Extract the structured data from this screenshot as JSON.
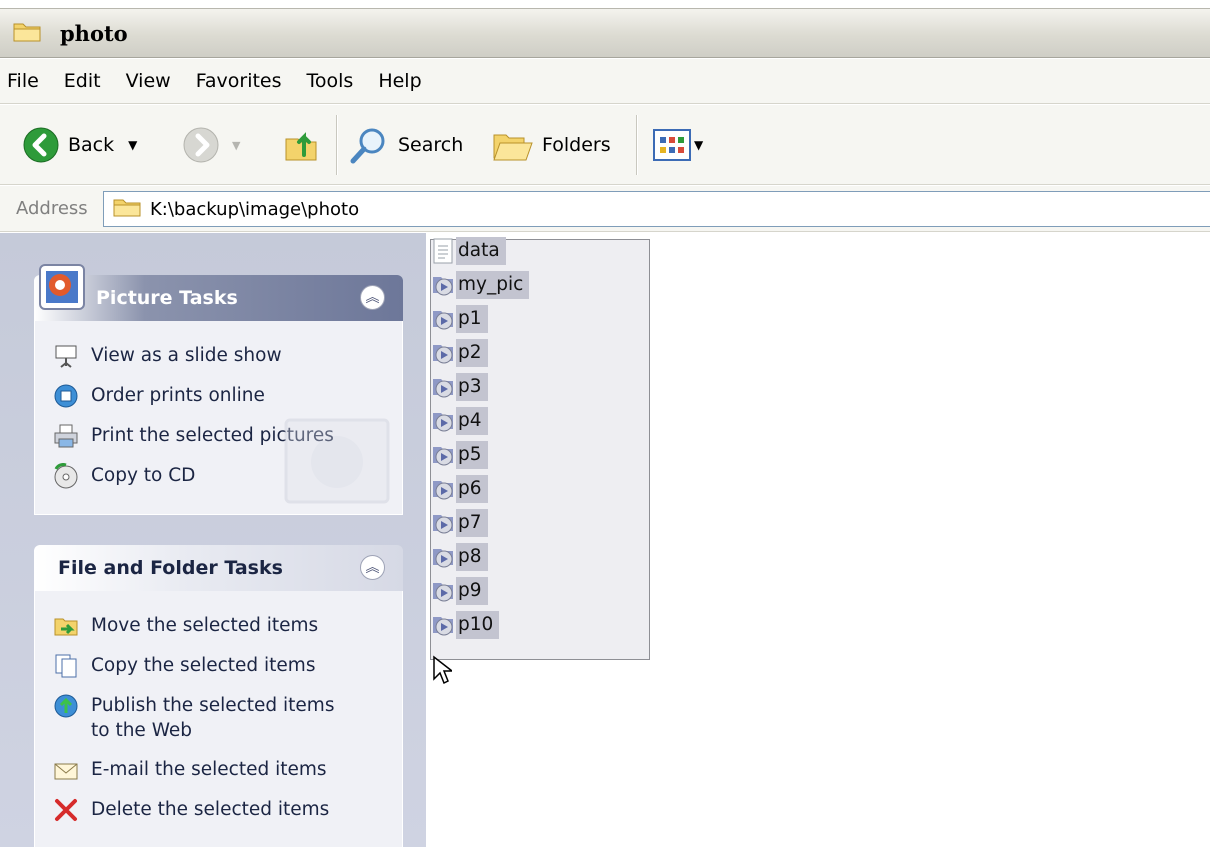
{
  "window": {
    "title": "photo"
  },
  "menu": [
    "File",
    "Edit",
    "View",
    "Favorites",
    "Tools",
    "Help"
  ],
  "toolbar": {
    "back_label": "Back",
    "search_label": "Search",
    "folders_label": "Folders"
  },
  "address": {
    "label": "Address",
    "path": "K:\\backup\\image\\photo"
  },
  "picture_tasks": {
    "title": "Picture Tasks",
    "items": [
      "View as a slide show",
      "Order prints online",
      "Print the selected pictures",
      "Copy to CD"
    ]
  },
  "file_tasks": {
    "title": "File and Folder Tasks",
    "items": [
      {
        "line1": "Move the selected items",
        "line2": ""
      },
      {
        "line1": "Copy the selected items",
        "line2": ""
      },
      {
        "line1": "Publish the selected items",
        "line2": "to the Web"
      },
      {
        "line1": "E-mail the selected items",
        "line2": ""
      },
      {
        "line1": "Delete the selected items",
        "line2": ""
      }
    ]
  },
  "files": [
    "data",
    "my_pic",
    "p1",
    "p2",
    "p3",
    "p4",
    "p5",
    "p6",
    "p7",
    "p8",
    "p9",
    "p10"
  ],
  "colors": {
    "accent": "#6d7799",
    "selection": "#c3c4d0",
    "address_border": "#7f9db9"
  }
}
